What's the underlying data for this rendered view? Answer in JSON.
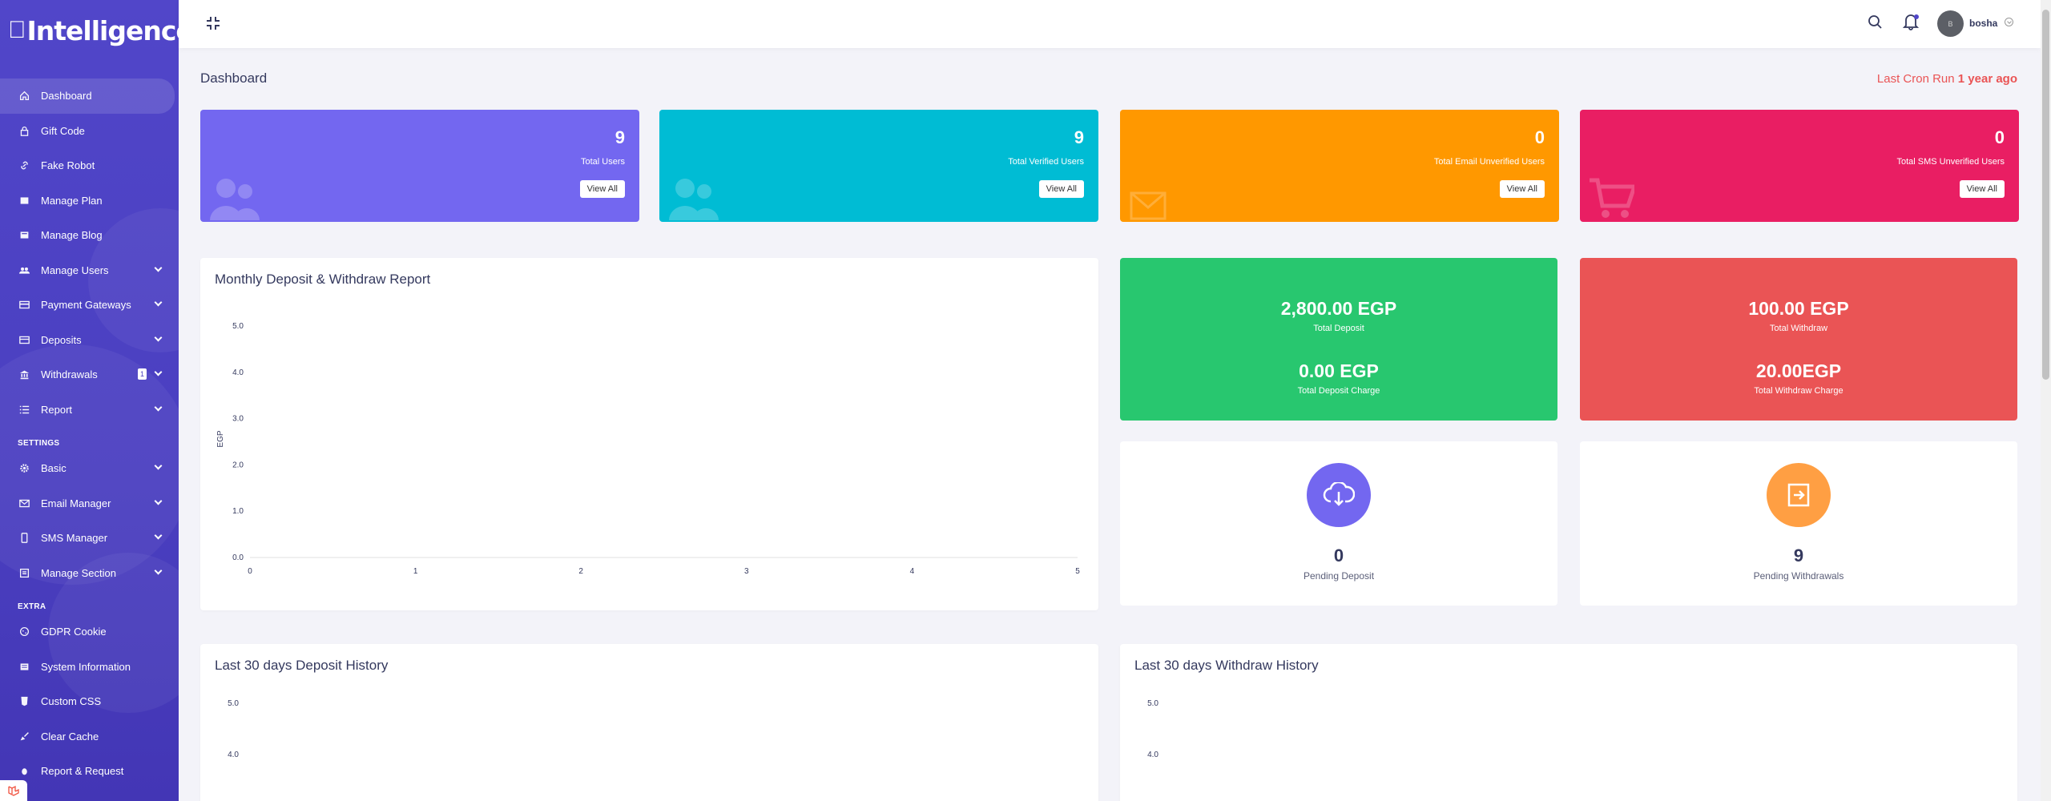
{
  "brand": {
    "logo_text": "Intelligence"
  },
  "sidebar": {
    "items": [
      {
        "label": "Dashboard"
      },
      {
        "label": "Gift Code"
      },
      {
        "label": "Fake Robot"
      },
      {
        "label": "Manage Plan"
      },
      {
        "label": "Manage Blog"
      },
      {
        "label": "Manage Users"
      },
      {
        "label": "Payment Gateways"
      },
      {
        "label": "Deposits"
      },
      {
        "label": "Withdrawals",
        "badge": "1"
      },
      {
        "label": "Report"
      }
    ],
    "settings_header": "SETTINGS",
    "settings_items": [
      {
        "label": "Basic"
      },
      {
        "label": "Email Manager"
      },
      {
        "label": "SMS Manager"
      },
      {
        "label": "Manage Section"
      }
    ],
    "extra_header": "EXTRA",
    "extra_items": [
      {
        "label": "GDPR Cookie"
      },
      {
        "label": "System Information"
      },
      {
        "label": "Custom CSS"
      },
      {
        "label": "Clear Cache"
      },
      {
        "label": "Report & Request"
      }
    ]
  },
  "topbar": {
    "username": "bosha",
    "avatar_text": "B"
  },
  "page": {
    "title": "Dashboard",
    "cron_label": "Last Cron Run",
    "cron_value": "1 year ago"
  },
  "widgets": [
    {
      "value": "9",
      "label": "Total Users",
      "button": "View All",
      "color": "#7367f0",
      "icon": "users-icon"
    },
    {
      "value": "9",
      "label": "Total Verified Users",
      "button": "View All",
      "color": "#00bcd4",
      "icon": "users-icon"
    },
    {
      "value": "0",
      "label": "Total Email Unverified Users",
      "button": "View All",
      "color": "#ff9800",
      "icon": "envelope-icon"
    },
    {
      "value": "0",
      "label": "Total SMS Unverified Users",
      "button": "View All",
      "color": "#e91e63",
      "icon": "cart-icon"
    }
  ],
  "monthly_report": {
    "title": "Monthly Deposit & Withdraw Report",
    "ylabel": "EGP"
  },
  "deposit_stats": {
    "total_deposit": "2,800.00 EGP",
    "total_deposit_label": "Total Deposit",
    "deposit_charge": "0.00 EGP",
    "deposit_charge_label": "Total Deposit Charge",
    "color": "#28c76f"
  },
  "withdraw_stats": {
    "total_withdraw": "100.00 EGP",
    "total_withdraw_label": "Total Withdraw",
    "withdraw_charge": "20.00EGP",
    "withdraw_charge_label": "Total Withdraw Charge",
    "color": "#ea5455"
  },
  "pending": {
    "deposit_value": "0",
    "deposit_label": "Pending Deposit",
    "withdraw_value": "9",
    "withdraw_label": "Pending Withdrawals"
  },
  "history": {
    "deposit_title": "Last 30 days Deposit History",
    "withdraw_title": "Last 30 days Withdraw History"
  },
  "chart_data": [
    {
      "type": "line",
      "ylabel": "EGP",
      "x": [
        0,
        1,
        2,
        3,
        4,
        5
      ],
      "xticks": [
        "0",
        "1",
        "2",
        "3",
        "4",
        "5"
      ],
      "yticks": [
        "0.0",
        "1.0",
        "2.0",
        "3.0",
        "4.0",
        "5.0"
      ],
      "ylim": [
        0,
        5
      ],
      "xlim": [
        0,
        5
      ],
      "series": [],
      "grid": false
    },
    {
      "type": "line",
      "yticks_visible": [
        "5.0",
        "4.0"
      ],
      "series": []
    },
    {
      "type": "line",
      "yticks_visible": [
        "5.0",
        "4.0"
      ],
      "series": []
    }
  ]
}
